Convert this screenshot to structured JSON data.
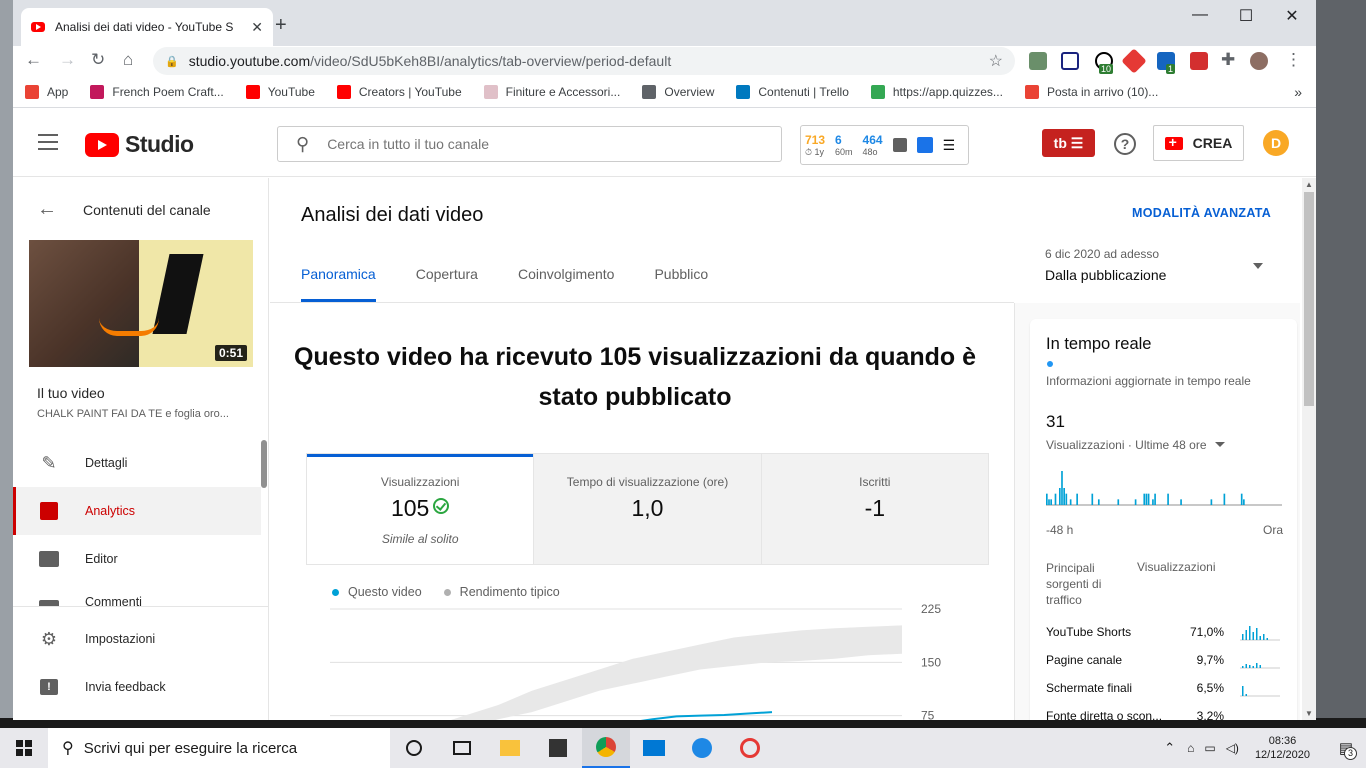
{
  "browser": {
    "tab_title": "Analisi dei dati video - YouTube S",
    "url_host": "studio.youtube.com",
    "url_path": "/video/SdU5bKeh8BI/analytics/tab-overview/period-default",
    "bookmarks": [
      {
        "label": "App",
        "color": "#ea4335"
      },
      {
        "label": "French Poem Craft...",
        "color": "#c2185b"
      },
      {
        "label": "YouTube",
        "color": "#ff0000"
      },
      {
        "label": "Creators | YouTube",
        "color": "#ff0000"
      },
      {
        "label": "Finiture e Accessori...",
        "color": "#e0c0c8"
      },
      {
        "label": "Overview",
        "color": "#5f6368"
      },
      {
        "label": "Contenuti | Trello",
        "color": "#0079bf"
      },
      {
        "label": "https://app.quizzes...",
        "color": "#34a853"
      },
      {
        "label": "Posta in arrivo (10)...",
        "color": "#ea4335"
      }
    ],
    "ext_badge_1": "10",
    "ext_badge_2": "1"
  },
  "header": {
    "studio_label": "Studio",
    "search_placeholder": "Cerca in tutto il tuo canale",
    "stats": [
      {
        "value": "713",
        "label": "1y",
        "color": "#f9a825"
      },
      {
        "value": "6",
        "label": "60m",
        "color": "#1e88e5"
      },
      {
        "value": "464",
        "label": "48o",
        "color": "#1e88e5"
      }
    ],
    "tb_label": "tb",
    "create_label": "CREA",
    "avatar_letter": "D"
  },
  "sidebar": {
    "back_label": "Contenuti del canale",
    "thumb_duration": "0:51",
    "your_video": "Il tuo video",
    "video_title": "CHALK PAINT FAI DA TE e foglia oro...",
    "items": [
      {
        "label": "Dettagli",
        "icon": "pencil-icon"
      },
      {
        "label": "Analytics",
        "icon": "analytics-icon",
        "active": true
      },
      {
        "label": "Editor",
        "icon": "clapper-icon"
      },
      {
        "label": "Commenti",
        "icon": "comments-icon"
      }
    ],
    "bottom_items": [
      {
        "label": "Impostazioni",
        "icon": "gear-icon"
      },
      {
        "label": "Invia feedback",
        "icon": "feedback-icon"
      }
    ]
  },
  "main": {
    "page_title": "Analisi dei dati video",
    "advanced_link": "MODALITÀ AVANZATA",
    "date_small": "6 dic 2020 ad adesso",
    "date_main": "Dalla pubblicazione",
    "tabs": [
      "Panoramica",
      "Copertura",
      "Coinvolgimento",
      "Pubblico"
    ],
    "headline": "Questo video ha ricevuto 105 visualizzazioni da quando è stato pubblicato",
    "metrics": [
      {
        "label": "Visualizzazioni",
        "value": "105",
        "note": "Simile al solito"
      },
      {
        "label": "Tempo di visualizzazione (ore)",
        "value": "1,0",
        "note": ""
      },
      {
        "label": "Iscritti",
        "value": "-1",
        "note": ""
      }
    ],
    "legend": [
      {
        "label": "Questo video",
        "color": "#00a1d6"
      },
      {
        "label": "Rendimento tipico",
        "color": "#b0b0b0"
      }
    ],
    "chart_ticks": [
      "225",
      "150",
      "75"
    ]
  },
  "realtime": {
    "title": "In tempo reale",
    "subtitle": "Informazioni aggiornate in tempo reale",
    "count": "31",
    "count_label": "Visualizzazioni · Ultime 48 ore",
    "axis_left": "-48 h",
    "axis_right": "Ora",
    "traffic_head_source": "Principali sorgenti di traffico",
    "traffic_head_views": "Visualizzazioni",
    "traffic": [
      {
        "name": "YouTube Shorts",
        "value": "71,0%"
      },
      {
        "name": "Pagine canale",
        "value": "9,7%"
      },
      {
        "name": "Schermate finali",
        "value": "6,5%"
      },
      {
        "name": "Fonte diretta o scon...",
        "value": "3,2%"
      }
    ]
  },
  "taskbar": {
    "search_placeholder": "Scrivi qui per eseguire la ricerca",
    "time": "08:36",
    "date": "12/12/2020",
    "notif_count": "3"
  },
  "chart_data": [
    {
      "type": "line",
      "title": "",
      "series": [
        {
          "name": "Questo video",
          "values": [
            0,
            5,
            10,
            15,
            20,
            28,
            35,
            40,
            45,
            50,
            58,
            65,
            70,
            74,
            75,
            76,
            78,
            80
          ]
        },
        {
          "name": "Rendimento tipico",
          "range_low": [
            0,
            10,
            20,
            40,
            55,
            70,
            80,
            95,
            110,
            120,
            130,
            140,
            145,
            150,
            152,
            155,
            160,
            162
          ],
          "range_high": [
            0,
            20,
            40,
            60,
            75,
            90,
            110,
            125,
            140,
            155,
            165,
            175,
            185,
            190,
            195,
            198,
            200,
            202
          ]
        }
      ],
      "ylim": [
        0,
        225
      ],
      "yticks": [
        225,
        150,
        75
      ]
    },
    {
      "type": "bar",
      "title": "Visualizzazioni · Ultime 48 ore",
      "values": [
        2,
        1,
        1,
        0,
        2,
        0,
        3,
        6,
        3,
        2,
        0,
        1,
        0,
        0,
        2,
        0,
        0,
        0,
        0,
        0,
        0,
        2,
        0,
        0,
        1,
        0,
        0,
        0,
        0,
        0,
        0,
        0,
        0,
        1,
        0,
        0,
        0,
        0,
        0,
        0,
        0,
        1,
        0,
        0,
        0,
        2,
        2,
        2,
        0,
        1,
        2,
        0,
        0,
        0,
        0,
        0,
        2,
        0,
        0,
        0,
        0,
        0,
        1,
        0,
        0,
        0,
        0,
        0,
        0,
        0,
        0,
        0,
        0,
        0,
        0,
        0,
        1,
        0,
        0,
        0,
        0,
        0,
        2,
        0,
        0,
        0,
        0,
        0,
        0,
        0,
        2,
        1,
        0,
        0,
        0,
        0,
        0,
        0,
        0,
        0,
        0,
        0,
        0,
        0,
        0,
        0,
        0,
        0,
        0
      ]
    }
  ]
}
